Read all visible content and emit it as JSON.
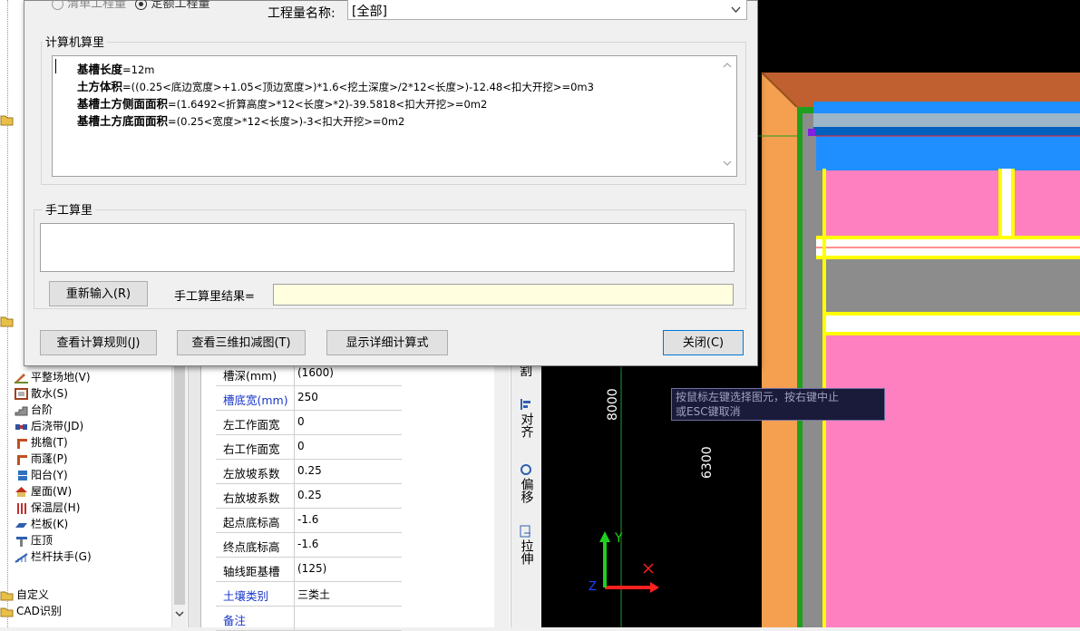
{
  "dialog": {
    "radio_partial": "清单工程量",
    "radio_selected": "定额工程量",
    "quantity_name_label": "工程量名称:",
    "quantity_name_value": "[全部]",
    "computer_calc_title": "计算机算里",
    "formula_lines": [
      {
        "name": "基槽长度",
        "expr": "=12m"
      },
      {
        "name": "土方体积",
        "expr": "=((0.25<底边宽度>+1.05<顶边宽度>)*1.6<挖土深度>/2*12<长度>)-12.48<扣大开挖>=0m3"
      },
      {
        "name": "基槽土方侧面面积",
        "expr": "=(1.6492<折算高度>*12<长度>*2)-39.5818<扣大开挖>=0m2"
      },
      {
        "name": "基槽土方底面面积",
        "expr": "=(0.25<宽度>*12<长度>)-3<扣大开挖>=0m2"
      }
    ],
    "manual_calc_title": "手工算里",
    "reinput_button": "重新输入(R)",
    "manual_result_label": "手工算里结果=",
    "manual_result_value": "",
    "view_rules_button": "查看计算规则(J)",
    "view_3d_button": "查看三维扣减图(T)",
    "show_detail_button": "显示详细计算式",
    "close_button": "关闭(C)"
  },
  "tree": {
    "items": [
      {
        "label": "平整场地(V)",
        "icon": "level-ground-icon"
      },
      {
        "label": "散水(S)",
        "icon": "apron-icon"
      },
      {
        "label": "台阶",
        "icon": "steps-icon"
      },
      {
        "label": "后浇带(JD)",
        "icon": "post-cast-strip-icon"
      },
      {
        "label": "挑檐(T)",
        "icon": "eave-icon"
      },
      {
        "label": "雨蓬(P)",
        "icon": "canopy-icon"
      },
      {
        "label": "阳台(Y)",
        "icon": "balcony-icon"
      },
      {
        "label": "屋面(W)",
        "icon": "roof-icon"
      },
      {
        "label": "保温层(H)",
        "icon": "insulation-icon"
      },
      {
        "label": "栏板(K)",
        "icon": "parapet-icon"
      },
      {
        "label": "压顶",
        "icon": "coping-icon"
      },
      {
        "label": "栏杆扶手(G)",
        "icon": "railing-icon"
      }
    ],
    "folders": [
      {
        "label": "自定义",
        "icon": "folder-icon"
      },
      {
        "label": "CAD识别",
        "icon": "folder-icon"
      }
    ]
  },
  "properties": {
    "rows": [
      {
        "name": "槽深(mm)",
        "value": "(1600)",
        "blue": false
      },
      {
        "name": "槽底宽(mm)",
        "value": "250",
        "blue": true
      },
      {
        "name": "左工作面宽",
        "value": "0",
        "blue": false
      },
      {
        "name": "右工作面宽",
        "value": "0",
        "blue": false
      },
      {
        "name": "左放坡系数",
        "value": "0.25",
        "blue": false
      },
      {
        "name": "右放坡系数",
        "value": "0.25",
        "blue": false
      },
      {
        "name": "起点底标高",
        "value": "-1.6",
        "blue": false
      },
      {
        "name": "终点底标高",
        "value": "-1.6",
        "blue": false
      },
      {
        "name": "轴线距基槽",
        "value": "(125)",
        "blue": false
      },
      {
        "name": "土壤类别",
        "value": "三类土",
        "blue": true
      },
      {
        "name": "备注",
        "value": "",
        "blue": true
      }
    ]
  },
  "toolbar": {
    "split": "割",
    "align": "对齐",
    "offset": "偏移",
    "stretch": "拉伸"
  },
  "canvas": {
    "dim_8000": "8000",
    "dim_6300": "6300",
    "tooltip_line1": "按鼠标左键选择图元，按右键中止",
    "tooltip_line2": "或ESC键取消",
    "axis_y": "Y",
    "axis_z": "Z",
    "axis_x": "X"
  },
  "colors": {
    "pink": "#ff80c0",
    "orange": "#f4a050",
    "blue": "#1f8fff",
    "gray": "#8c8c8c",
    "yellow": "#ffff00",
    "green": "#1ea01e"
  }
}
